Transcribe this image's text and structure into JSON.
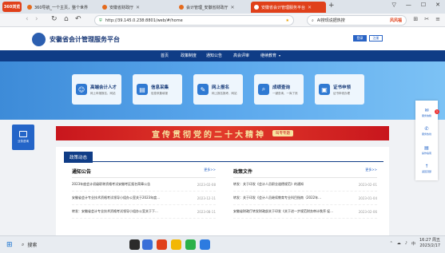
{
  "browser": {
    "logo_label": "360浏览",
    "tabs": [
      {
        "label": "360导航_一个主页，整个世界",
        "active": false
      },
      {
        "label": "安徽省财政厅",
        "active": false
      },
      {
        "label": "会计管理_安徽省财政厅",
        "active": false
      },
      {
        "label": "安徽省会计管理服务平台",
        "active": true
      }
    ],
    "new_tab": "+",
    "url": "http://39.145.0.238:8801/web/#/home",
    "search_placeholder": "AI搜现说据热搜",
    "search_tag": "风风福",
    "window_controls": [
      "▽",
      "—",
      "☐",
      "✕"
    ]
  },
  "site": {
    "title": "安徽省会计管理服务平台",
    "login": "登录",
    "register": "注册",
    "nav": [
      "首页",
      "政策制度",
      "通知公告",
      "高会评审",
      "继续教育"
    ],
    "cards": [
      {
        "title": "高端会计人才",
        "sub": "网上申报报名、网站"
      },
      {
        "title": "信息采集",
        "sub": "信息采集填报"
      },
      {
        "title": "网上报名",
        "sub": "网上报名报考、网站"
      },
      {
        "title": "成绩查询",
        "sub": "一键查询、一库了然"
      },
      {
        "title": "证书申领",
        "sub": "证书申领办理"
      }
    ],
    "left_float_label": "业务咨询",
    "banner_text": "宣传贯彻党的二十大精神",
    "banner_badge": "叫专专题",
    "news_heading": "政策动态",
    "notices": {
      "title": "通知公告",
      "more": "更多>>",
      "items": [
        {
          "text": "2023年度会计初级职称资格考试安徽考区报名简章公告",
          "date": "2023-02-08"
        },
        {
          "text": "安徽省会计专业技术资格考试领导小组办公室关于2023年度...",
          "date": "2023-12-11"
        },
        {
          "text": "转发：安徽省会计专业技术资格考试领导小组办公室关于下...",
          "date": "2023-08-11"
        }
      ]
    },
    "policies": {
      "title": "政策文件",
      "more": "更多>>",
      "items": [
        {
          "text": "转发：关于印发《会计人员职业道德规范》的通知",
          "date": "2023-02-01"
        },
        {
          "text": "转发：关于印发《会计人员继续教育专业科目指南（2022年...",
          "date": "2023-01-04"
        },
        {
          "text": "安徽省财政厅转发财政部关于印发《关于进一步规范财务审计秩序 促...",
          "date": "2023-02-06"
        }
      ]
    },
    "right_float": [
      {
        "icon": "✉",
        "label": "服务信箱",
        "badge": "1"
      },
      {
        "icon": "✆",
        "label": "服务热线"
      },
      {
        "icon": "▤",
        "label": "操作指南"
      },
      {
        "icon": "↑",
        "label": "返回顶部"
      }
    ]
  },
  "taskbar": {
    "search": "搜索",
    "time": "16:27 周五",
    "date": "2023/2/17",
    "lang": "中"
  }
}
